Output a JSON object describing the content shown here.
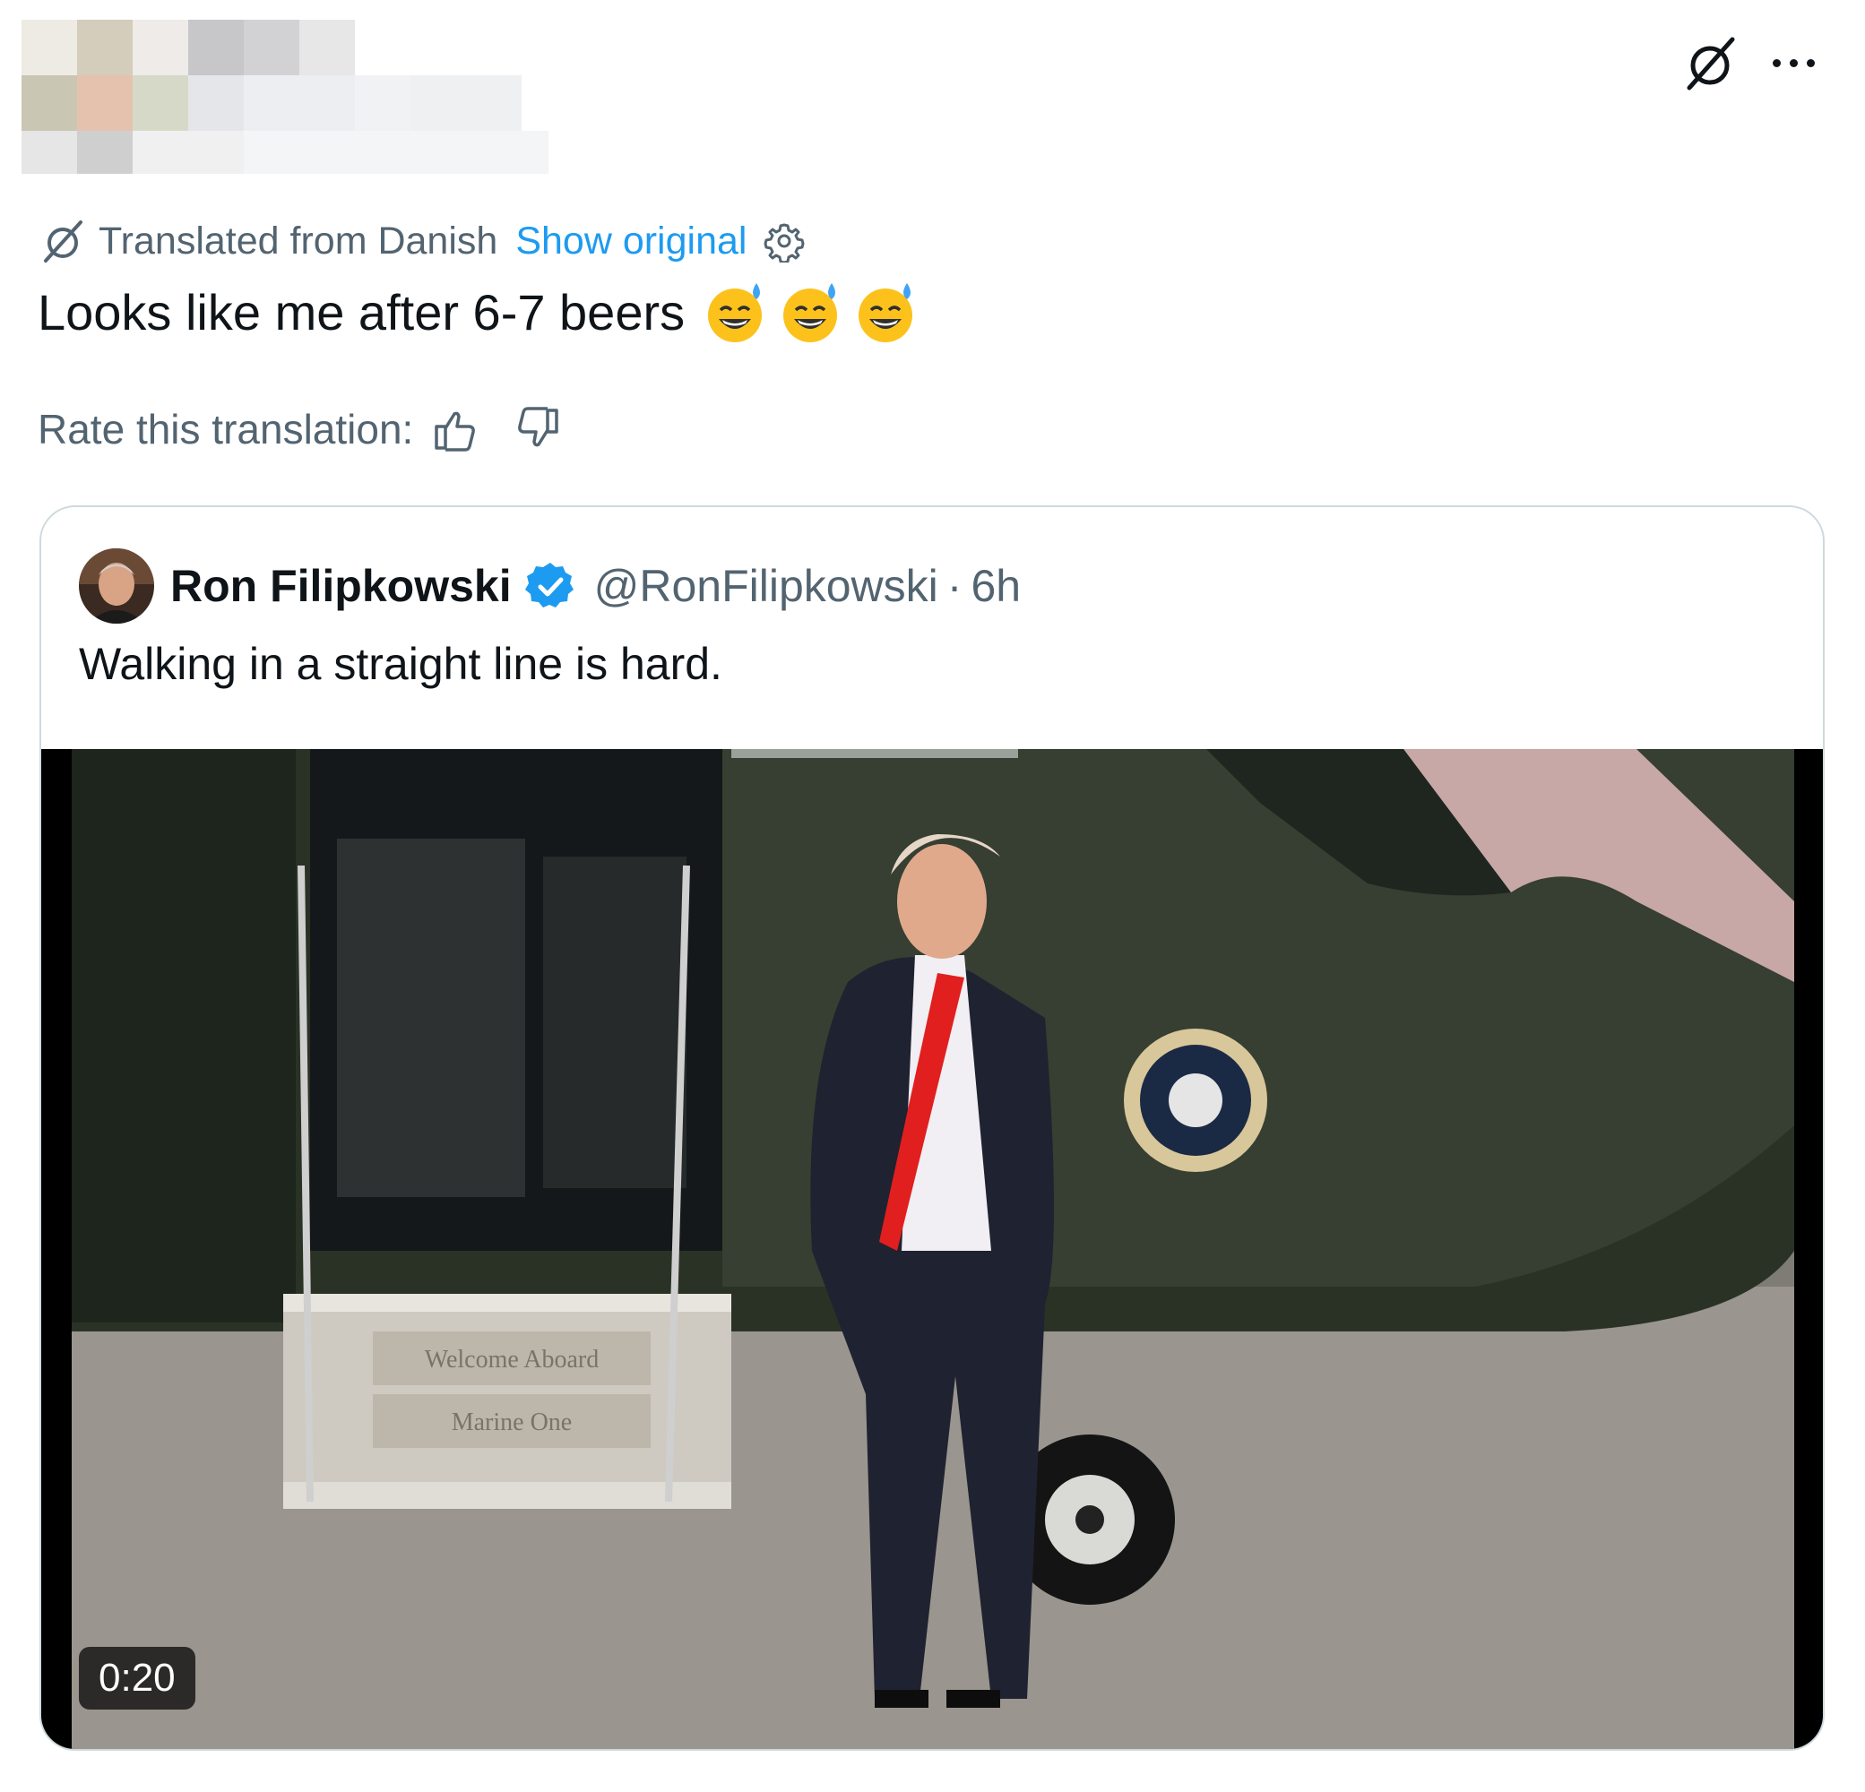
{
  "header": {
    "author_blurred": true
  },
  "translation": {
    "label": "Translated from Danish",
    "show_original": "Show original"
  },
  "tweet": {
    "text": "Looks like me after 6-7 beers",
    "emojis": [
      "sweat-smile-emoji",
      "sweat-smile-emoji",
      "sweat-smile-emoji"
    ]
  },
  "rating": {
    "label": "Rate this translation:"
  },
  "quoted": {
    "name": "Ron Filipkowski",
    "handle": "@RonFilipkowski",
    "separator": "·",
    "time": "6h",
    "text": "Walking in a straight line is hard.",
    "media": {
      "type": "video",
      "duration": "0:20",
      "sign_line1": "Welcome Aboard",
      "sign_line2": "Marine One"
    }
  },
  "colors": {
    "accent": "#1d9bf0",
    "secondary_text": "#536471",
    "border": "#cfd9de"
  }
}
